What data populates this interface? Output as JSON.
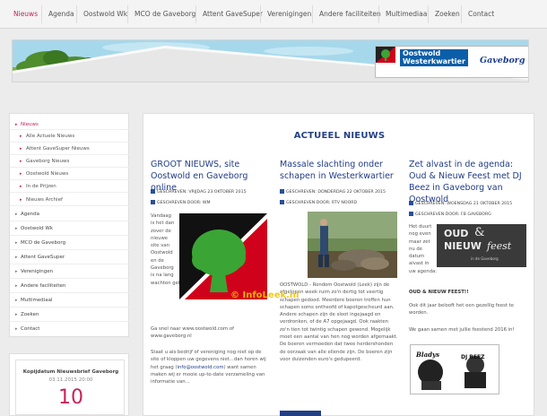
{
  "topnav": {
    "items": [
      {
        "label": "Nieuws",
        "active": true
      },
      {
        "label": "Agenda"
      },
      {
        "label": "Oostwold Wk"
      },
      {
        "label": "MCO de Gaveborg"
      },
      {
        "label": "Attent GaveSuper"
      },
      {
        "label": "Verenigingen"
      },
      {
        "label": "Andere faciliteiten"
      },
      {
        "label": "Multimediaal"
      },
      {
        "label": "Zoeken"
      },
      {
        "label": "Contact"
      }
    ]
  },
  "banner": {
    "logo_title_line1": "Oostwold",
    "logo_title_line2": "Westerkwartier",
    "logo_brand": "Gaveborg",
    "sky_color": "#9fd4e9"
  },
  "sidebar": {
    "items": [
      {
        "label": "Nieuws",
        "level": 0,
        "active": true
      },
      {
        "label": "Alle Actuele Nieuws",
        "level": 1
      },
      {
        "label": "Attent GaveSuper Nieuws",
        "level": 1
      },
      {
        "label": "Gaveborg Nieuws",
        "level": 1
      },
      {
        "label": "Oostwold Nieuws",
        "level": 1
      },
      {
        "label": "In de Prijzen",
        "level": 1
      },
      {
        "label": "Nieuws Archief",
        "level": 1
      },
      {
        "label": "Agenda",
        "level": 0
      },
      {
        "label": "Oostwold Wk",
        "level": 0
      },
      {
        "label": "MCO de Gaveborg",
        "level": 0
      },
      {
        "label": "Attent GaveSuper",
        "level": 0
      },
      {
        "label": "Verenigingen",
        "level": 0
      },
      {
        "label": "Andere faciliteiten",
        "level": 0
      },
      {
        "label": "Multimediaal",
        "level": 0
      },
      {
        "label": "Zoeken",
        "level": 0
      },
      {
        "label": "Contact",
        "level": 0
      }
    ]
  },
  "newsletter": {
    "title": "Kopijdatum Nieuwsbrief Gaveborg",
    "date": "03.11.2015 20:00",
    "number": "10"
  },
  "main": {
    "title": "ACTUEEL NIEUWS",
    "articles": [
      {
        "title": "GROOT NIEUWS, site Oostwold en Gaveborg online",
        "meta_date": "GESCHREVEN: VRIJDAG 23 OKTOBER 2015",
        "meta_author": "GESCHREVEN DOOR: WM",
        "wrap_lines": [
          "Vandaag",
          "is het dan",
          "zover de",
          "nieuwe",
          "site van",
          "Oostwold",
          "en de",
          "Gaveborg",
          "is na lang",
          "wachten geboren."
        ],
        "p2": "Ga snel naar www.oostwold.com of www.gaveborg.nl",
        "p3_before": "Staat u als bedrijf of vereniging nog niet op de site of kloppen uw gegevens niet...dan horen wij het graag (",
        "p3_link": "info@oostwold.com",
        "p3_after": ") want samen maken wij er mooie up-to-date verzameling van informatie van..."
      },
      {
        "title": "Massale slachting onder schapen in Westerkwartier",
        "meta_date": "GESCHREVEN: DONDERDAG 22 OKTOBER 2015",
        "meta_author": "GESCHREVEN DOOR: RTV NOORD",
        "body": "OOSTWOLD - Rondom Oostwold (Leek) zijn de afgelopen week ruim zo'n dertig tot veertig schapen gedood. Meerdere boeren troffen hun schapen soms ontheofd of kapotgescheurd aan. Andere schapen zijn de sloot ingejaagd en verdronken, of de A7 opgejaagd. Ook raakten zo'n tien tot twintig schapen gewond. Mogelijk moet een aantal van hen nog worden afgemaakt. De boeren vermoeden dat twee herdershonden de oorzaak van alle ellende zijn. De boeren zijn voor duizenden euro's gedupeerd."
      },
      {
        "title": "Zet alvast in de agenda: Oud & Nieuw Feest met DJ Beez in Gaveborg van Oostwold",
        "meta_date": "GESCHREVEN: WOENSDAG 21 OKTOBER 2015",
        "meta_author": "GESCHREVEN DOOR: FB GAVEBORG",
        "wrap_lines": [
          "Het duurt",
          "nog even",
          "maar zet",
          "nu de",
          "datum",
          "alvast in",
          "uw agenda:"
        ],
        "subhead": "OUD & NIEUW FEEST!!",
        "p2": "Ook dit jaar belooft het een gezellig feest te worden.",
        "p3": "We gaan samen met jullie feestend 2016 in!",
        "flyer_line1": "OUD",
        "flyer_line2": "&",
        "flyer_line3": "NIEUW",
        "flyer_line4": "feest",
        "flyer_sub": "in de Gaveborg",
        "dj_label": "DJ BEEZ",
        "dj_script": "Bladys"
      }
    ]
  },
  "watermark": "© InfoLeek.nl",
  "colors": {
    "accent": "#c7235a",
    "title_blue": "#1f3c88"
  }
}
